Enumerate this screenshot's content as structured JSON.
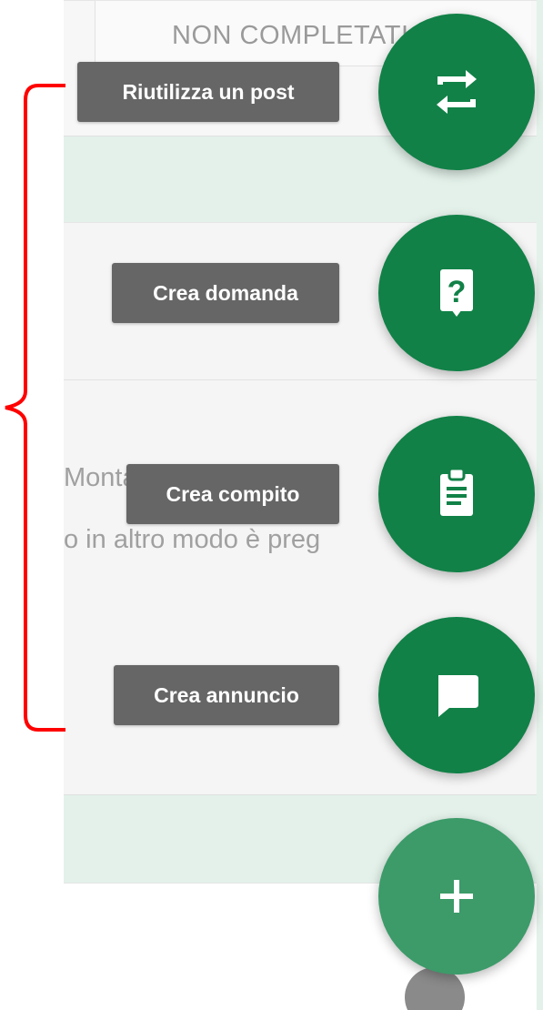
{
  "background": {
    "status_column_header": "NON COMPLETATI",
    "post_body_line1": "Montalcini che vi ho",
    "post_body_line2": "o in altro modo è preg"
  },
  "speed_dial": {
    "actions": [
      {
        "label": "Riutilizza un post",
        "icon": "repost-icon"
      },
      {
        "label": "Crea domanda",
        "icon": "question-icon"
      },
      {
        "label": "Crea compito",
        "icon": "assignment-icon"
      },
      {
        "label": "Crea annuncio",
        "icon": "announcement-icon"
      }
    ],
    "main_button_icon": "plus-icon"
  },
  "colors": {
    "fab_green": "#118147",
    "fab_main_green": "#3c9b69",
    "label_gray": "#666666",
    "annotation_red": "#ff0000"
  }
}
